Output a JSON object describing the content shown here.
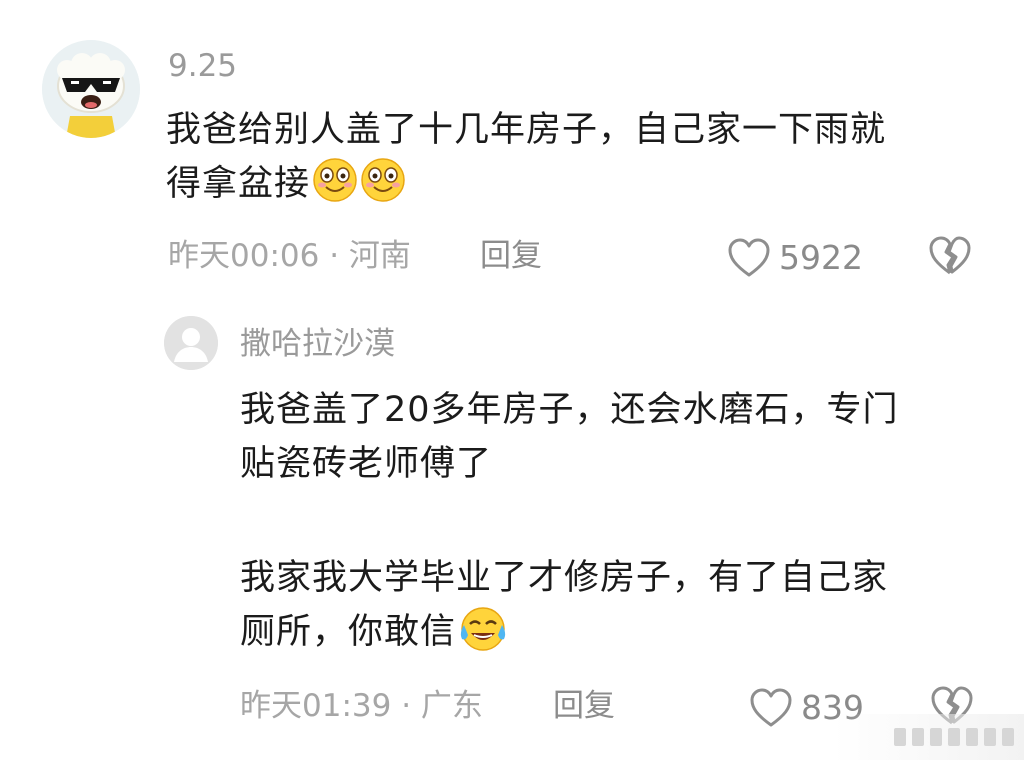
{
  "comments": [
    {
      "username": "9.25",
      "body_lines": [
        "我爸给别人盖了十几年房子，自己家一下雨就",
        "得拿盆接"
      ],
      "emojis": [
        "smile-emoji",
        "smile-emoji"
      ],
      "time": "昨天00:06",
      "location": "河南",
      "reply_label": "回复",
      "likes": "5922",
      "icons": {
        "like": "heart-icon",
        "dislike": "broken-heart-icon",
        "avatar": "sheep-sunglasses-avatar"
      }
    },
    {
      "username": "撒哈拉沙漠",
      "body_lines": [
        "我爸盖了20多年房子，还会水磨石，专门",
        "贴瓷砖老师傅了",
        "",
        "我家我大学毕业了才修房子，有了自己家",
        "厕所，你敢信"
      ],
      "emojis": [
        "tears-of-joy-emoji"
      ],
      "time": "昨天01:39",
      "location": "广东",
      "reply_label": "回复",
      "likes": "839",
      "icons": {
        "like": "heart-icon",
        "dislike": "broken-heart-icon",
        "avatar": "default-user-avatar"
      }
    }
  ],
  "separator": " · ",
  "colors": {
    "text": "#1b1b1b",
    "muted": "#a6a6a6",
    "username": "#9a9a9a",
    "emoji": "#ffd43b"
  }
}
